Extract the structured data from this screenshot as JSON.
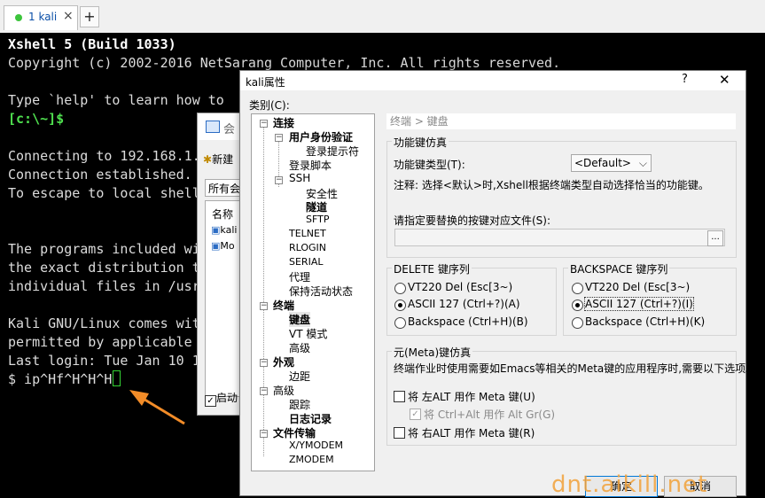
{
  "tab": {
    "label": "1 kali",
    "close": "×",
    "add": "+"
  },
  "terminal": {
    "lines": [
      "Xshell 5 (Build 1033)",
      "Copyright (c) 2002-2016 NetSarang Computer, Inc. All rights reserved.",
      "Type `help' to learn how to",
      "[c:\\~]$",
      "Connecting to 192.168.1.",
      "Connection established.",
      "To escape to local shell",
      "The programs included wi",
      "the exact distribution t",
      "individual files in /usr",
      "Kali GNU/Linux comes wit",
      "permitted by applicable",
      "Last login: Tue Jan 10 1",
      "$ ip^Hf^H^H^H"
    ]
  },
  "session_dialog": {
    "title": "会",
    "new": "新建",
    "filter": "所有会",
    "col_name": "名称",
    "row1": "kali",
    "row2": "Mo",
    "startup": "启动"
  },
  "dialog": {
    "title": "kali属性",
    "help": "?",
    "close": "✕",
    "category_label": "类别(C):",
    "tree": {
      "connection": "连接",
      "auth": "用户身份验证",
      "login_prompt": "登录提示符",
      "login_script": "登录脚本",
      "ssh": "SSH",
      "security": "安全性",
      "tunnel": "隧道",
      "sftp": "SFTP",
      "telnet": "TELNET",
      "rlogin": "RLOGIN",
      "serial": "SERIAL",
      "proxy": "代理",
      "keepalive": "保持活动状态",
      "terminal": "终端",
      "keyboard": "键盘",
      "vt_mode": "VT 模式",
      "advanced1": "高级",
      "appearance": "外观",
      "margin": "边距",
      "advanced2": "高级",
      "trace": "跟踪",
      "logging": "日志记录",
      "file_transfer": "文件传输",
      "xymodem": "X/YMODEM",
      "zmodem": "ZMODEM"
    },
    "breadcrumb": "终端 > 键盘",
    "fkey": {
      "group": "功能键仿真",
      "type_label": "功能键类型(T):",
      "type_value": "<Default>",
      "note": "注释: 选择<默认>时,Xshell根据终端类型自动选择恰当的功能键。",
      "file_label": "请指定要替换的按键对应文件(S):",
      "browse": "..."
    },
    "delete": {
      "group": "DELETE 键序列",
      "opt1": "VT220 Del (Esc[3~)",
      "opt2": "ASCII 127 (Ctrl+?)(A)",
      "opt3": "Backspace (Ctrl+H)(B)"
    },
    "backspace": {
      "group": "BACKSPACE 键序列",
      "opt1": "VT220 Del (Esc[3~)",
      "opt2": "ASCII 127 (Ctrl+?)(I)",
      "opt3": "Backspace (Ctrl+H)(K)"
    },
    "meta": {
      "group": "元(Meta)键仿真",
      "desc": "终端作业时使用需要如Emacs等相关的Meta键的应用程序时,需要以下选项。",
      "left_alt": "将 左ALT 用作 Meta 键(U)",
      "ctrl_alt": "将 Ctrl+Alt 用作 Alt Gr(G)",
      "right_alt": "将 右ALT 用作 Meta 键(R)"
    },
    "ok": "确定",
    "cancel": "取消"
  },
  "watermark": "dnt.aikill.net"
}
